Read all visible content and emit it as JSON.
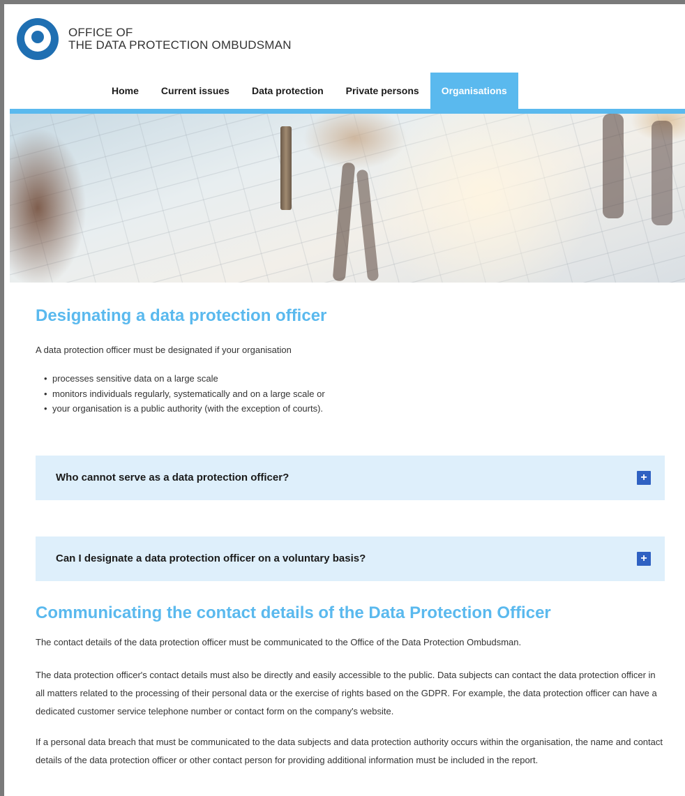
{
  "header": {
    "logo_line1": "OFFICE OF",
    "logo_line2": "THE DATA PROTECTION OMBUDSMAN"
  },
  "nav": {
    "items": [
      {
        "label": "Home",
        "active": false
      },
      {
        "label": "Current issues",
        "active": false
      },
      {
        "label": "Data protection",
        "active": false
      },
      {
        "label": "Private persons",
        "active": false
      },
      {
        "label": "Organisations",
        "active": true
      }
    ],
    "accent_color": "#5ab9ee"
  },
  "section1": {
    "title": "Designating a data protection officer",
    "intro": "A data protection officer must be designated if your organisation",
    "bullets": [
      "processes sensitive data on a large scale",
      "monitors individuals regularly, systematically and on a large scale or",
      "your organisation is a public authority (with the exception of courts)."
    ]
  },
  "accordions": [
    {
      "question": "Who cannot serve as a data protection officer?",
      "toggle": "+"
    },
    {
      "question": "Can I designate a data protection officer on a voluntary basis?",
      "toggle": "+"
    }
  ],
  "section2": {
    "title": "Communicating the contact details of the Data Protection Officer",
    "paragraphs": [
      "The contact details of the data protection officer must be communicated to the Office of the Data Protection Ombudsman.",
      "The data protection officer's contact details must also be directly and easily accessible to the public. Data subjects can contact the data protection officer in all matters related to the processing of their personal data or the exercise of rights based on the GDPR. For example, the data protection officer can have a dedicated customer service telephone number or contact form on the company's website.",
      "If a personal data breach that must be communicated to the data subjects and data protection authority occurs within the organisation, the name and contact details of the data protection officer or other contact person for providing additional information must be included in the report."
    ]
  },
  "colors": {
    "heading": "#5ab9ee",
    "accordion_bg": "#deeffb",
    "toggle_bg": "#2f61c2",
    "logo_blue": "#1f6fb2"
  },
  "icons": {
    "logo": "ombudsman-logo-icon",
    "toggle": "plus-icon"
  }
}
